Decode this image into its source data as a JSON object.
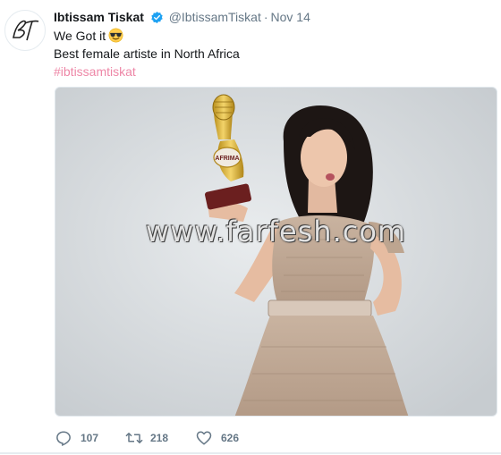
{
  "tweet": {
    "author": {
      "display_name": "Ibtissam Tiskat",
      "handle": "@IbtissamTiskat",
      "avatar_text": "BT",
      "verified": true
    },
    "separator": "·",
    "timestamp": "Nov 14",
    "text_lines": [
      "We Got it",
      "Best female artiste in North Africa"
    ],
    "emoji": "smiling-face-with-sunglasses",
    "hashtag": "#ibtissamtiskat",
    "media": {
      "watermark": "www.farfesh.com",
      "trophy_label": "AFRIMA"
    },
    "actions": {
      "replies": "107",
      "retweets": "218",
      "likes": "626"
    }
  },
  "colors": {
    "verified": "#1da1f2",
    "hashtag": "#e0245e",
    "secondary_text": "#657786"
  }
}
